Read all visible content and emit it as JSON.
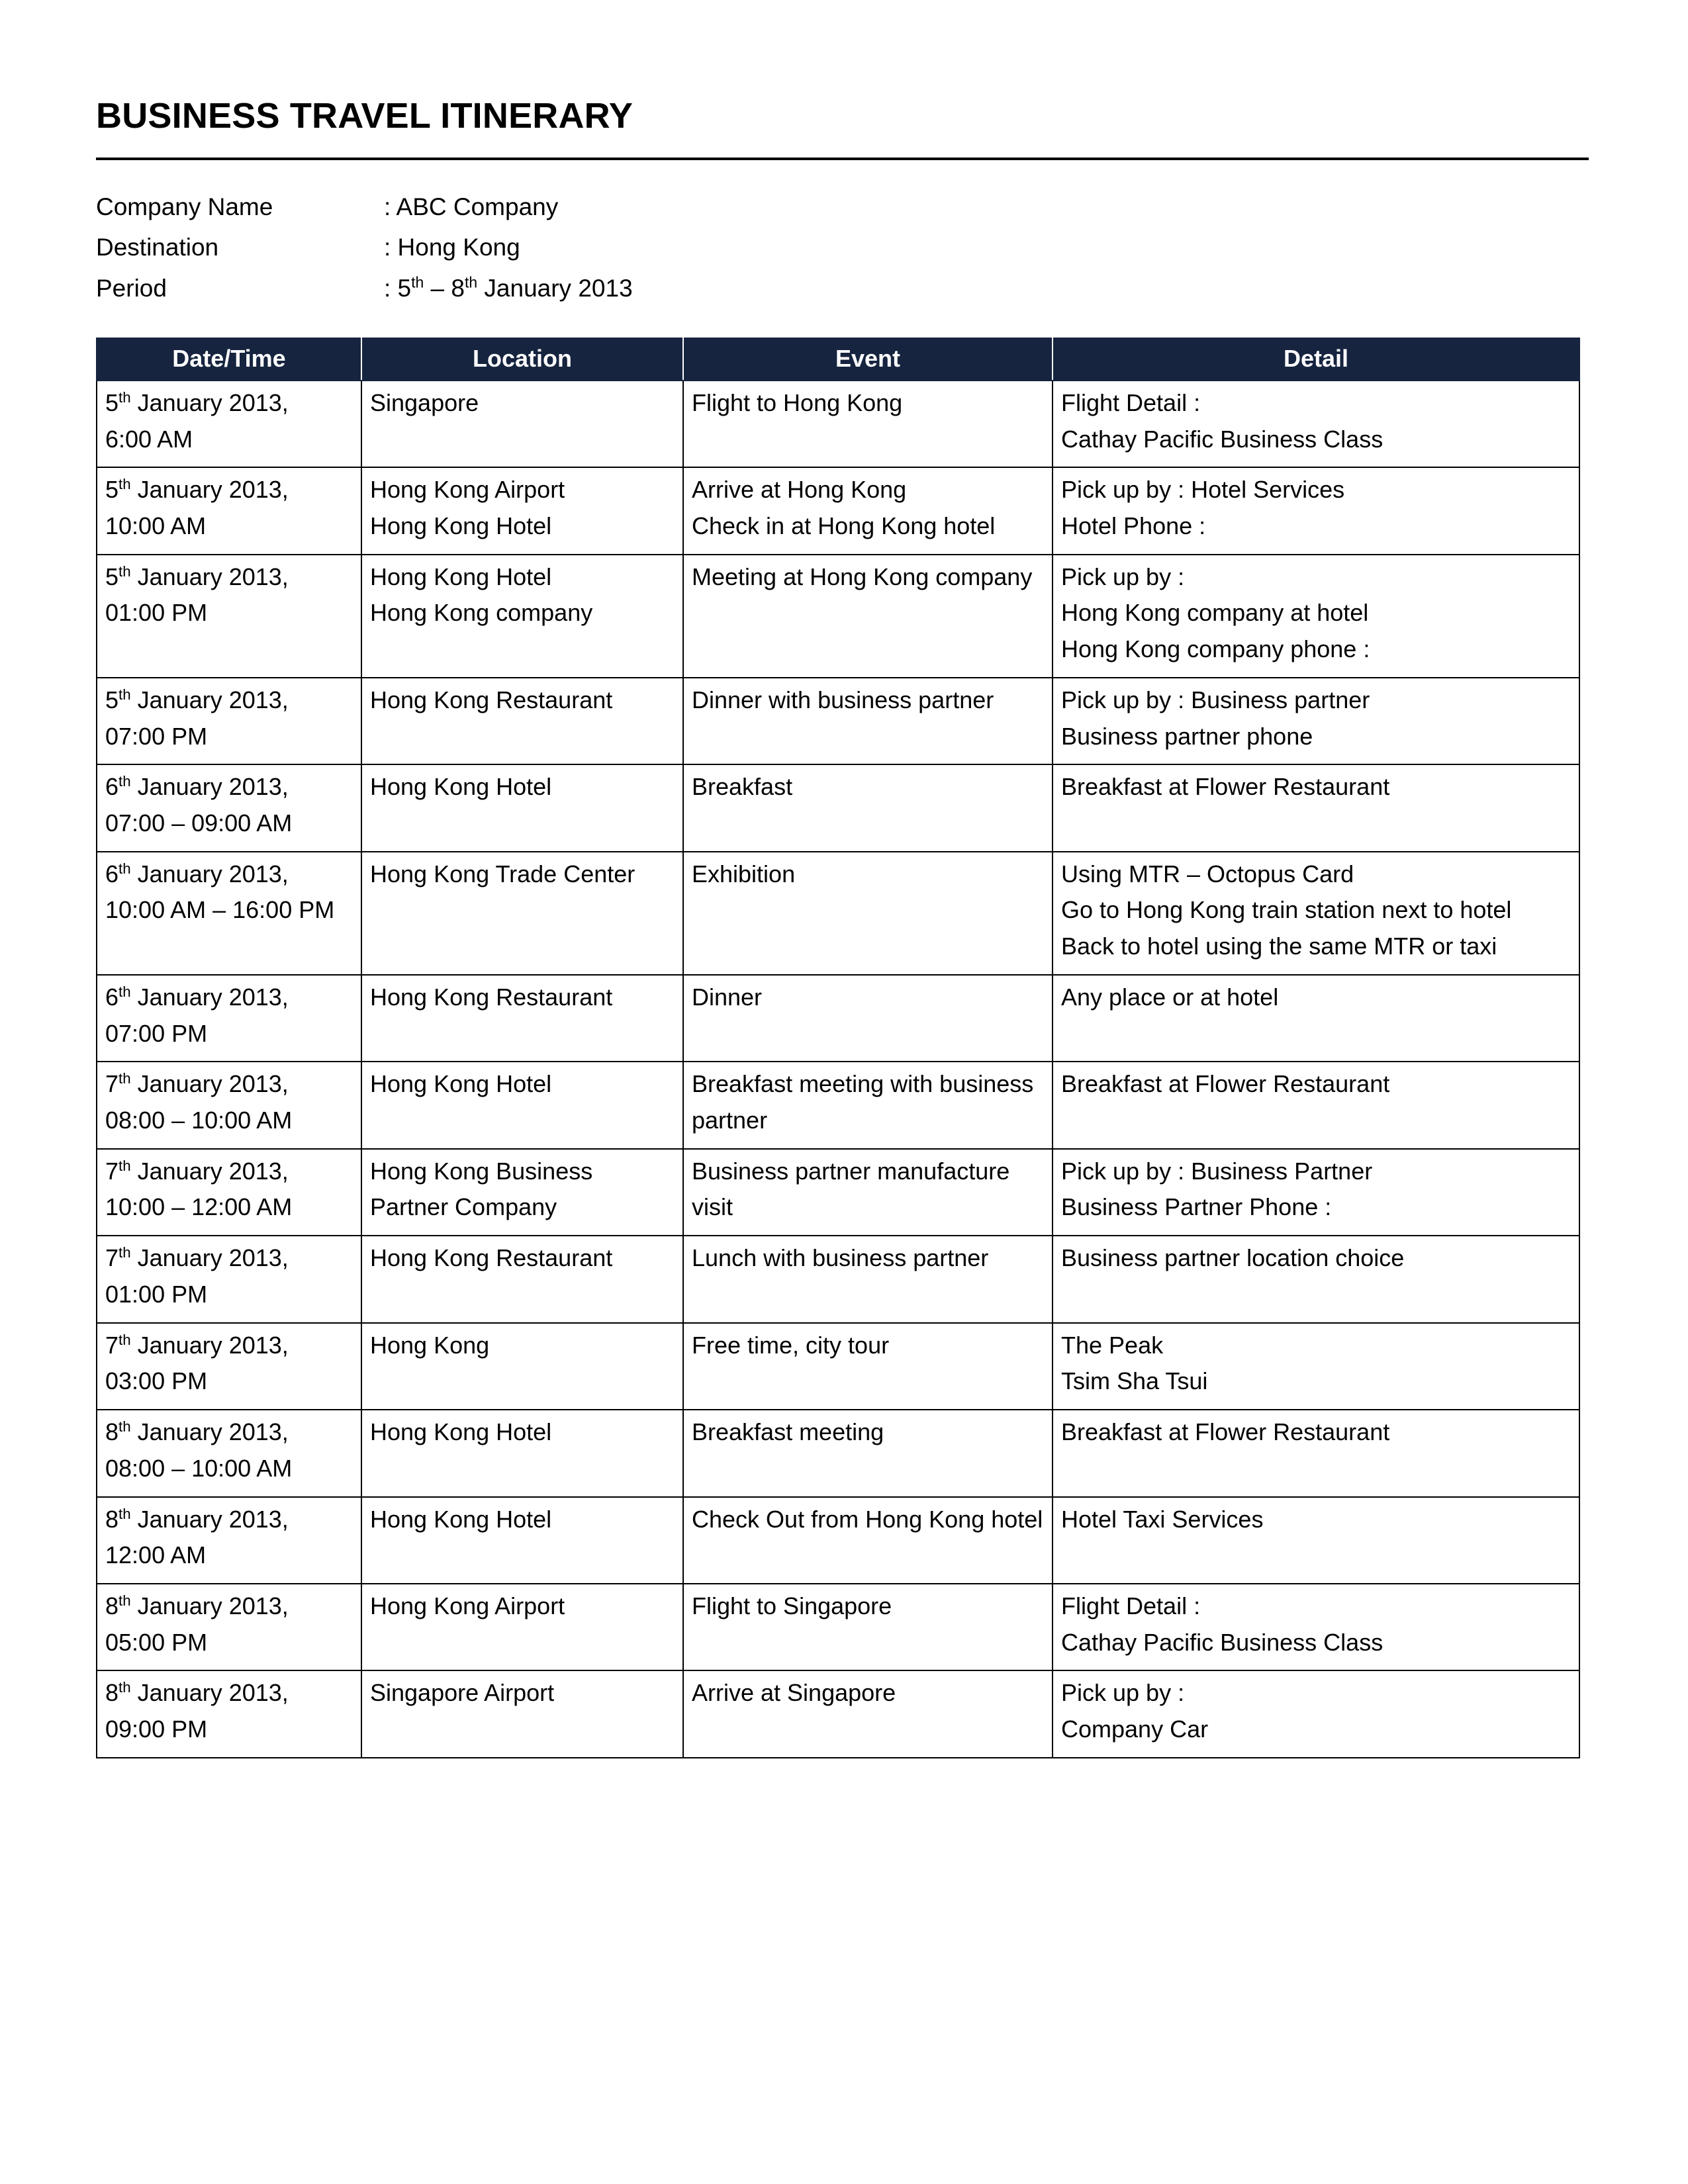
{
  "document": {
    "title": "BUSINESS TRAVEL ITINERARY"
  },
  "meta": {
    "rows": [
      {
        "label": "Company Name",
        "value": ": ABC Company"
      },
      {
        "label": "Destination",
        "value": ": Hong Kong"
      },
      {
        "label": "Period",
        "value": ": 5th – 8th January 2013",
        "value_html": true
      }
    ],
    "period_prefix": ": 5",
    "period_sup1": "th",
    "period_mid": " – 8",
    "period_sup2": "th",
    "period_suffix": " January 2013"
  },
  "table": {
    "headers": [
      "Date/Time",
      "Location",
      "Event",
      "Detail"
    ],
    "header_bg": "#16243f",
    "header_color": "#ffffff",
    "border_color": "#000000",
    "rows": [
      {
        "date_num": "5",
        "date_sup": "th",
        "date_rest": " January 2013,",
        "time": "6:00 AM",
        "location": [
          "Singapore"
        ],
        "event": [
          "Flight to Hong Kong"
        ],
        "detail": [
          "Flight Detail :",
          "Cathay Pacific Business Class"
        ]
      },
      {
        "date_num": "5",
        "date_sup": "th",
        "date_rest": " January 2013,",
        "time": "10:00 AM",
        "location": [
          "Hong Kong Airport",
          "Hong Kong Hotel"
        ],
        "event": [
          "Arrive at Hong Kong",
          "Check in at Hong Kong hotel"
        ],
        "detail": [
          "Pick up by : Hotel Services",
          "Hotel Phone :"
        ]
      },
      {
        "date_num": "5",
        "date_sup": "th",
        "date_rest": " January 2013,",
        "time": "01:00 PM",
        "location": [
          "Hong Kong Hotel",
          "Hong Kong company"
        ],
        "event": [
          "Meeting at Hong Kong company"
        ],
        "detail": [
          "Pick up by :",
          "Hong Kong company at hotel",
          "Hong Kong company phone :"
        ]
      },
      {
        "date_num": "5",
        "date_sup": "th",
        "date_rest": " January 2013,",
        "time": "07:00 PM",
        "location": [
          "Hong Kong Restaurant"
        ],
        "event": [
          "Dinner with business partner"
        ],
        "detail": [
          "Pick up by : Business partner",
          "Business partner phone"
        ]
      },
      {
        "date_num": "6",
        "date_sup": "th",
        "date_rest": " January 2013,",
        "time": "07:00 – 09:00 AM",
        "location": [
          "Hong Kong Hotel"
        ],
        "event": [
          "Breakfast"
        ],
        "detail": [
          "Breakfast at Flower Restaurant"
        ]
      },
      {
        "date_num": "6",
        "date_sup": "th",
        "date_rest": " January 2013,",
        "time": "10:00 AM – 16:00 PM",
        "location": [
          "Hong Kong Trade Center"
        ],
        "event": [
          "Exhibition"
        ],
        "detail": [
          "Using MTR – Octopus Card",
          "Go to Hong Kong train station next to hotel",
          "Back to hotel using the same MTR or taxi"
        ]
      },
      {
        "date_num": "6",
        "date_sup": "th",
        "date_rest": " January 2013,",
        "time": "07:00 PM",
        "location": [
          "Hong Kong Restaurant"
        ],
        "event": [
          "Dinner"
        ],
        "detail": [
          "Any place or at hotel"
        ]
      },
      {
        "date_num": "7",
        "date_sup": "th",
        "date_rest": " January 2013,",
        "time": "08:00 – 10:00 AM",
        "location": [
          "Hong Kong Hotel"
        ],
        "event": [
          "Breakfast meeting with business partner"
        ],
        "detail": [
          "Breakfast at Flower Restaurant"
        ]
      },
      {
        "date_num": "7",
        "date_sup": "th",
        "date_rest": " January 2013,",
        "time": "10:00 – 12:00 AM",
        "location": [
          "Hong Kong Business Partner Company"
        ],
        "event": [
          "Business partner manufacture visit"
        ],
        "detail": [
          "Pick up by : Business Partner",
          "Business Partner Phone :"
        ]
      },
      {
        "date_num": "7",
        "date_sup": "th",
        "date_rest": " January 2013,",
        "time": "01:00 PM",
        "location": [
          "Hong Kong Restaurant"
        ],
        "event": [
          "Lunch with business partner"
        ],
        "detail": [
          "Business partner location choice"
        ]
      },
      {
        "date_num": "7",
        "date_sup": "th",
        "date_rest": " January 2013,",
        "time": "03:00 PM",
        "location": [
          "Hong Kong"
        ],
        "event": [
          "Free time, city tour"
        ],
        "detail": [
          "The Peak",
          "Tsim Sha Tsui"
        ]
      },
      {
        "date_num": "8",
        "date_sup": "th",
        "date_rest": " January 2013,",
        "time": "08:00 – 10:00 AM",
        "location": [
          "Hong Kong Hotel"
        ],
        "event": [
          "Breakfast meeting"
        ],
        "detail": [
          "Breakfast at Flower Restaurant"
        ]
      },
      {
        "date_num": "8",
        "date_sup": "th",
        "date_rest": " January 2013,",
        "time": "12:00 AM",
        "location": [
          "Hong Kong Hotel"
        ],
        "event": [
          "Check Out from Hong Kong hotel"
        ],
        "detail": [
          "Hotel Taxi Services"
        ]
      },
      {
        "date_num": "8",
        "date_sup": "th",
        "date_rest": " January 2013,",
        "time": "05:00 PM",
        "location": [
          "Hong Kong Airport"
        ],
        "event": [
          "Flight to Singapore"
        ],
        "detail": [
          "Flight Detail :",
          "Cathay Pacific Business Class"
        ]
      },
      {
        "date_num": "8",
        "date_sup": "th",
        "date_rest": " January 2013,",
        "time": "09:00 PM",
        "location": [
          "Singapore Airport"
        ],
        "event": [
          "Arrive at Singapore"
        ],
        "detail": [
          "Pick up by :",
          "Company Car"
        ]
      }
    ]
  }
}
